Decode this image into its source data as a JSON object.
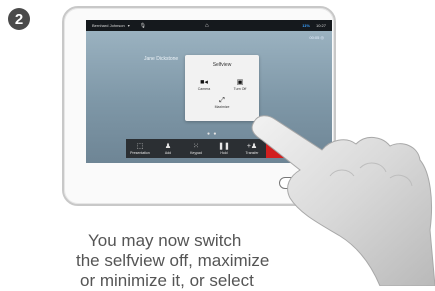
{
  "step": "2",
  "topbar": {
    "user": "Bernhard Johnson",
    "caret": "▾",
    "mic_icon": "mic-icon",
    "home_icon": "home-icon",
    "signal": "11%",
    "clock": "10:27"
  },
  "status": {
    "text": "00:05  ◎"
  },
  "participant": {
    "name": "Jane Dickstone"
  },
  "selfview_popup": {
    "title": "Selfview",
    "buttons": [
      {
        "label": "Camera",
        "icon": "camera-icon"
      },
      {
        "label": "Turn Off",
        "icon": "person-off-icon"
      },
      {
        "label": "Maximize",
        "icon": "maximize-icon"
      }
    ]
  },
  "pager": "● ●",
  "toolbar": [
    {
      "label": "Presentation",
      "icon": "share-icon"
    },
    {
      "label": "Add",
      "icon": "add-person-icon"
    },
    {
      "label": "Keypad",
      "icon": "keypad-icon"
    },
    {
      "label": "Hold",
      "icon": "pause-icon"
    },
    {
      "label": "Transfer",
      "icon": "transfer-icon"
    },
    {
      "label": "",
      "icon": "end-call-icon"
    }
  ],
  "caption": {
    "line1": "You may now switch",
    "line2": "the selfview off, maximize",
    "line3": "or minimize it, or select"
  }
}
